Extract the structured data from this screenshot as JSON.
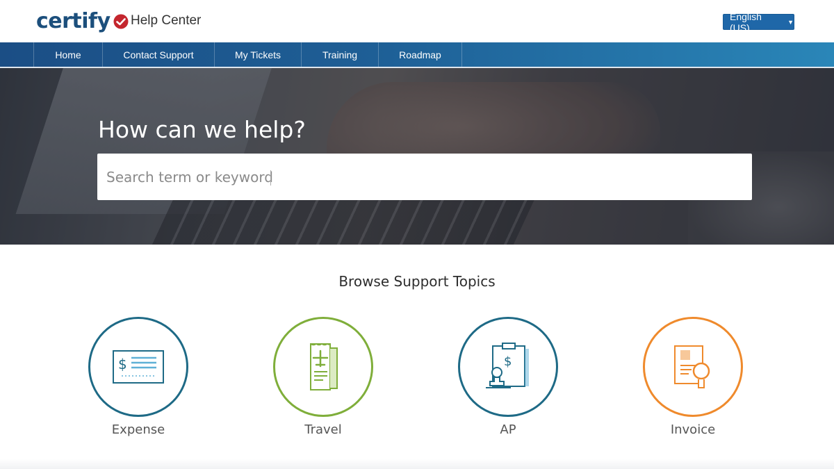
{
  "header": {
    "logo_text": "certify",
    "title": "Help Center",
    "language": "English (US)"
  },
  "nav": {
    "items": [
      {
        "label": "Home"
      },
      {
        "label": "Contact Support"
      },
      {
        "label": "My Tickets"
      },
      {
        "label": "Training"
      },
      {
        "label": "Roadmap"
      }
    ]
  },
  "hero": {
    "title": "How can we help?",
    "search_placeholder": "Search term or keyword"
  },
  "topics": {
    "title": "Browse Support Topics",
    "items": [
      {
        "label": "Expense",
        "icon": "expense-check-icon",
        "color": "#1e6a86"
      },
      {
        "label": "Travel",
        "icon": "travel-ticket-icon",
        "color": "#7fae3a"
      },
      {
        "label": "AP",
        "icon": "ap-stamp-icon",
        "color": "#1e6a86"
      },
      {
        "label": "Invoice",
        "icon": "invoice-magnifier-icon",
        "color": "#ef8a2c"
      }
    ]
  },
  "colors": {
    "brand_blue": "#1c4f7c",
    "brand_red": "#c4262e",
    "nav_blue": "#1e5f96"
  }
}
